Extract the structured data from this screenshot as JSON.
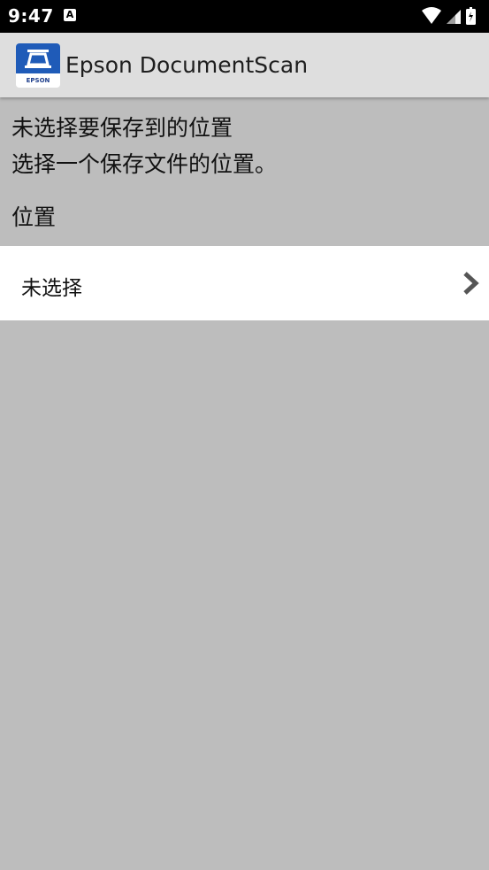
{
  "status_bar": {
    "time": "9:47",
    "notification_glyph": "A",
    "icons": [
      "wifi-icon",
      "signal-icon",
      "battery-icon"
    ]
  },
  "app_bar": {
    "icon_brand": "EPSON",
    "title": "Epson DocumentScan"
  },
  "content": {
    "message_line1": "未选择要保存到的位置",
    "message_line2": "选择一个保存文件的位置。",
    "section_label": "位置",
    "location_value": "未选择"
  },
  "colors": {
    "background": "#bdbdbd",
    "app_bar": "#dedede",
    "status_bar": "#000000",
    "row_background": "#ffffff",
    "brand_blue": "#1f5bb8"
  }
}
